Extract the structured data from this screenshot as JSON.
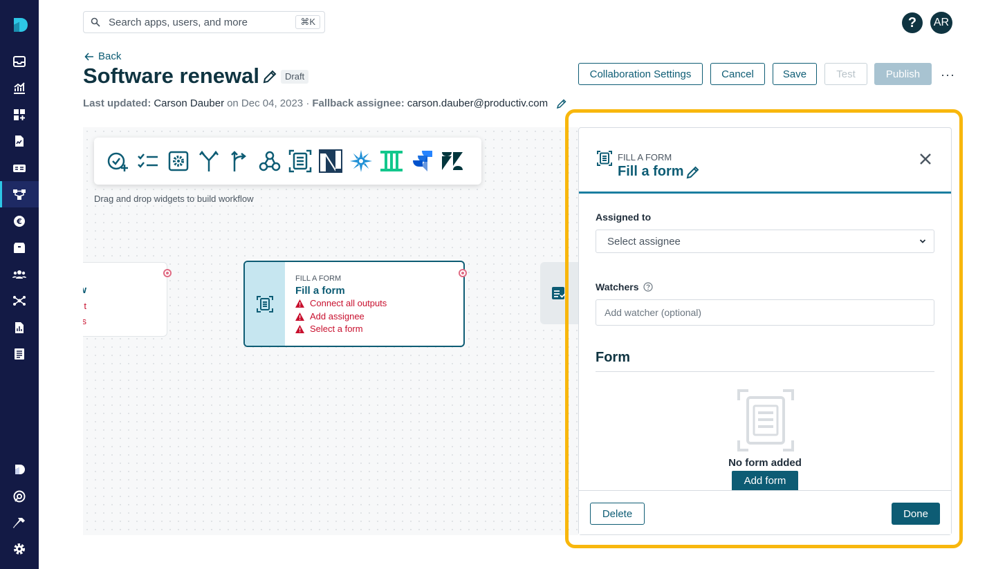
{
  "sidebar": {
    "items": [
      {
        "icon": "inbox-icon"
      },
      {
        "icon": "analytics-icon"
      },
      {
        "icon": "apps-add-icon"
      },
      {
        "icon": "contract-icon"
      },
      {
        "icon": "spend-icon"
      },
      {
        "icon": "workflow-icon",
        "active": true
      },
      {
        "icon": "currency-icon"
      },
      {
        "icon": "package-icon"
      },
      {
        "icon": "users-icon"
      },
      {
        "icon": "integrations-icon"
      },
      {
        "icon": "report-icon"
      },
      {
        "icon": "document-icon"
      }
    ],
    "bottom_items": [
      {
        "icon": "productiv-logo-icon"
      },
      {
        "icon": "support-icon"
      },
      {
        "icon": "hammer-icon"
      },
      {
        "icon": "settings-icon"
      }
    ]
  },
  "search": {
    "placeholder": "Search apps, users, and more",
    "shortcut": "⌘K"
  },
  "topbar": {
    "help_label": "?",
    "avatar_initials": "AR"
  },
  "header": {
    "back_label": "Back",
    "title": "Software renewal",
    "badge": "Draft",
    "updated_label": "Last updated:",
    "updated_by": "Carson Dauber",
    "updated_on": "on Dec 04, 2023 ·",
    "fallback_label": "Fallback assignee:",
    "fallback_email": "carson.dauber@productiv.com"
  },
  "actions": {
    "collab": "Collaboration Settings",
    "cancel": "Cancel",
    "save": "Save",
    "test": "Test",
    "publish": "Publish",
    "more": "···"
  },
  "canvas": {
    "hint": "Drag and drop widgets to build workflow",
    "widgets": [
      "approval-add-icon",
      "checklist-icon",
      "settings-box-icon",
      "merge-icon",
      "branch-icon",
      "webhook-icon",
      "form-icon",
      "netsuite-logo-icon",
      "coupa-logo-icon",
      "ironclad-logo-icon",
      "jira-logo-icon",
      "zendesk-logo-icon"
    ],
    "left_node": {
      "line1": "w",
      "line2": "t",
      "line3": "uts"
    },
    "node": {
      "type": "FILL A FORM",
      "name": "Fill a form",
      "warnings": [
        "Connect all outputs",
        "Add assignee",
        "Select a form"
      ]
    }
  },
  "panel": {
    "type": "FILL A FORM",
    "name": "Fill a form",
    "assigned_label": "Assigned to",
    "assignee_placeholder": "Select assignee",
    "watchers_label": "Watchers",
    "watcher_placeholder": "Add watcher (optional)",
    "form_heading": "Form",
    "empty_text": "No form added",
    "add_form": "Add form",
    "delete": "Delete",
    "done": "Done"
  },
  "colors": {
    "brand": "#0d5c74",
    "sidebar": "#131a45",
    "highlight": "#f8b70d",
    "error": "#c8102e"
  }
}
